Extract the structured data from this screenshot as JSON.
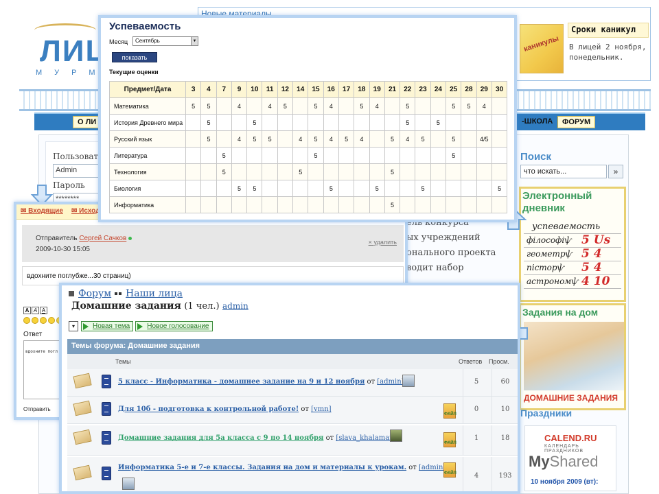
{
  "background": {
    "logo": {
      "text": "ЛИЦ",
      "sub": "МУРМ"
    },
    "news_link": "Новые материалы",
    "vacation": {
      "image_text": "каникулы",
      "title": "Сроки каникул",
      "text": [
        "В лицей 2 ноября,",
        "понедельник."
      ]
    },
    "menu": {
      "item1": "О ЛИ",
      "item2": "-ШКОЛА",
      "item3": "ФОРУМ"
    },
    "login": {
      "user_label": "Пользовате",
      "user_value": "Admin",
      "pass_label": "Пароль",
      "pass_value": "********"
    },
    "right": {
      "search_title": "Поиск",
      "search_placeholder": "что искать...",
      "search_button": "»",
      "diary_title": "Электронный дневник",
      "diary_rows": [
        {
          "word": "успеваемость",
          "mark": ""
        },
        {
          "word": "філософіѱ",
          "mark": "5 Us"
        },
        {
          "word": "геометрѱ",
          "mark": "5 4"
        },
        {
          "word": "пісторѱ",
          "mark": "5 4"
        },
        {
          "word": "астрономѱ",
          "mark": "4 10"
        }
      ],
      "tasks_title": "Задания на дом",
      "tasks_caption": "ДОМАШНИЕ ЗАДАНИЯ",
      "holidays_title": "Праздники",
      "calend_logo": "CALEND.RU",
      "calend_sub": "КАЛЕНДАРЬ ПРАЗДНИКОВ",
      "calend_date": "10 ноября 2009 (вт):"
    },
    "article_lines": [
      "ель конкурса",
      "ых учреждений",
      "онального проекта",
      "водит набор"
    ],
    "watermark": {
      "a": "My",
      "b": "Shared"
    }
  },
  "inbox": {
    "tab_inbox": "Входящие",
    "tab_outbox": "Исход",
    "sender_label": "Отправитель",
    "sender_name": "Сергей Сачков",
    "date": "2009-10-30 15:05",
    "delete_label": "удалить",
    "delete_mark": "×",
    "body": "вдохните поглубже...30 страниц)",
    "format_buttons": [
      "A",
      "A",
      "A"
    ],
    "reply_label": "Ответ",
    "reply_text": "вдохните погл",
    "send_label": "Отправить"
  },
  "grades": {
    "title": "Успеваемость",
    "month_label": "Месяц",
    "month_value": "Сентябрь",
    "show_button": "показать",
    "subtitle": "Текущие оценки",
    "subject_header": "Предмет/Дата",
    "dates": [
      "3",
      "4",
      "7",
      "9",
      "10",
      "11",
      "12",
      "14",
      "15",
      "16",
      "17",
      "18",
      "19",
      "21",
      "22",
      "23",
      "24",
      "25",
      "28",
      "29",
      "30"
    ],
    "rows": [
      {
        "subject": "Математика",
        "marks": [
          "5",
          "5",
          "",
          "4",
          "",
          "4",
          "5",
          "",
          "5",
          "4",
          "",
          "5",
          "4",
          "",
          "5",
          "",
          "",
          "5",
          "5",
          "4",
          ""
        ]
      },
      {
        "subject": "История Древнего мира",
        "marks": [
          "",
          "5",
          "",
          "",
          "5",
          "",
          "",
          "",
          "",
          "",
          "",
          "",
          "",
          "",
          "5",
          "",
          "5",
          "",
          "",
          "",
          ""
        ]
      },
      {
        "subject": "Русский язык",
        "marks": [
          "",
          "5",
          "",
          "4",
          "5",
          "5",
          "",
          "4",
          "5",
          "4",
          "5",
          "4",
          "",
          "5",
          "4",
          "5",
          "",
          "5",
          "",
          "4/5",
          ""
        ]
      },
      {
        "subject": "Литература",
        "marks": [
          "",
          "",
          "5",
          "",
          "",
          "",
          "",
          "",
          "5",
          "",
          "",
          "",
          "",
          "",
          "",
          "",
          "",
          "5",
          "",
          "",
          ""
        ]
      },
      {
        "subject": "Технология",
        "marks": [
          "",
          "",
          "5",
          "",
          "",
          "",
          "",
          "5",
          "",
          "",
          "",
          "",
          "",
          "5",
          "",
          "",
          "",
          "",
          "",
          "",
          ""
        ]
      },
      {
        "subject": "Биология",
        "marks": [
          "",
          "",
          "",
          "5",
          "5",
          "",
          "",
          "",
          "",
          "5",
          "",
          "",
          "5",
          "",
          "",
          "5",
          "",
          "",
          "",
          "",
          "5"
        ]
      },
      {
        "subject": "Информатика",
        "marks": [
          "",
          "",
          "",
          "",
          "",
          "",
          "",
          "",
          "",
          "",
          "",
          "",
          "",
          "5",
          "",
          "",
          "",
          "",
          "",
          "",
          ""
        ]
      }
    ]
  },
  "forum": {
    "crumb_forum": "Форум",
    "crumb_faces": "Наши лица",
    "section": "Домашние задания",
    "section_count": "(1 чел.)",
    "section_admin": "admin",
    "dropdown": "▾",
    "new_topic": "Новая тема",
    "new_poll": "Новое голосование",
    "category_title": "Темы форума: Домашние задания",
    "col_topics": "Темы",
    "col_replies": "Ответов",
    "col_views": "Просм.",
    "file_label": "ФАЙЛ",
    "topics": [
      {
        "title": "5 класс - Информатика - домашнее задание на 9 и 12 ноября",
        "by": "от",
        "author": "[admin]",
        "replies": "5",
        "views": "60"
      },
      {
        "title": "Для 10б - подготовка к контрольной работе!",
        "by": "от",
        "author": "[vmn]",
        "replies": "0",
        "views": "10"
      },
      {
        "title": "Домашние задания для 5а класса с 9 по 14 ноября",
        "by": "от",
        "author": "[slava_khalaman]",
        "replies": "1",
        "views": "18"
      },
      {
        "title": "Информатика 5-е и 7-е классы. Задания на дом и материалы к урокам.",
        "by": "от",
        "author": "[admin]",
        "replies": "4",
        "views": "193"
      }
    ]
  },
  "colors": {
    "accent": "#2f7cc0",
    "panel_border": "#b8d4f2",
    "header_yellow": "#fdf6d4",
    "forum_cat": "#7d9fbf"
  }
}
